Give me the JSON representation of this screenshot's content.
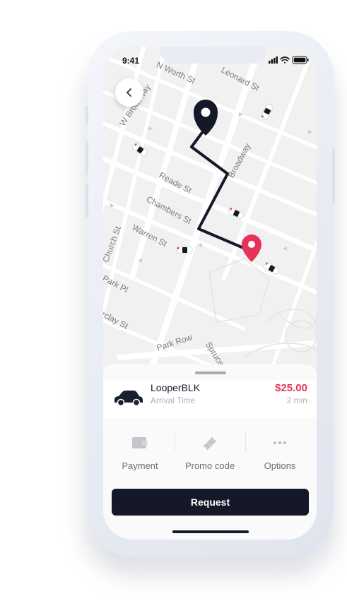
{
  "status_bar": {
    "time": "9:41"
  },
  "map": {
    "streets": [
      "Leonard St",
      "N Worth St",
      "W Broadway",
      "Broadway",
      "Reade St",
      "Chambers St",
      "Warren St",
      "Church St",
      "Park Pl",
      "Barclay St",
      "Park Row",
      "Spruce"
    ]
  },
  "ride": {
    "name": "LooperBLK",
    "subtitle": "Arrival Time",
    "price": "$25.00",
    "eta": "2 min"
  },
  "options": [
    {
      "label": "Payment",
      "icon": "wallet-icon"
    },
    {
      "label": "Promo code",
      "icon": "ticket-icon"
    },
    {
      "label": "Options",
      "icon": "more-dots-icon"
    }
  ],
  "request_label": "Request",
  "colors": {
    "accent": "#e8325a",
    "dark": "#141827",
    "map_bg": "#f3f3f3"
  }
}
